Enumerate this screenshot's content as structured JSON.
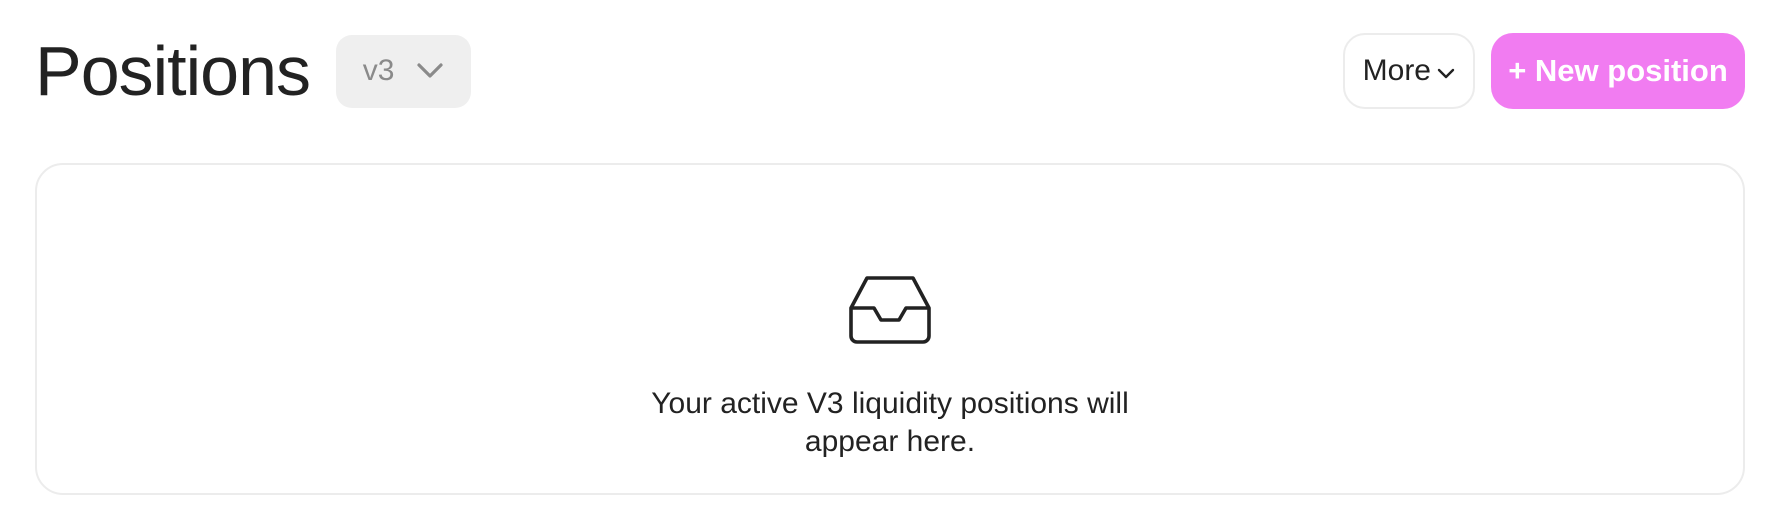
{
  "header": {
    "title": "Positions",
    "version_select": {
      "value": "v3",
      "icon": "chevron-down-icon"
    },
    "more_button": {
      "label": "More",
      "icon": "chevron-down-icon"
    },
    "new_position_button": {
      "label": "+ New position"
    }
  },
  "empty_state": {
    "icon": "inbox-icon",
    "message": "Your active V3 liquidity positions will appear here."
  },
  "colors": {
    "accent": "#f17cf1",
    "select_bg": "#efefef",
    "border": "#ececec",
    "text": "#222222",
    "muted_text": "#8a8a8a"
  }
}
